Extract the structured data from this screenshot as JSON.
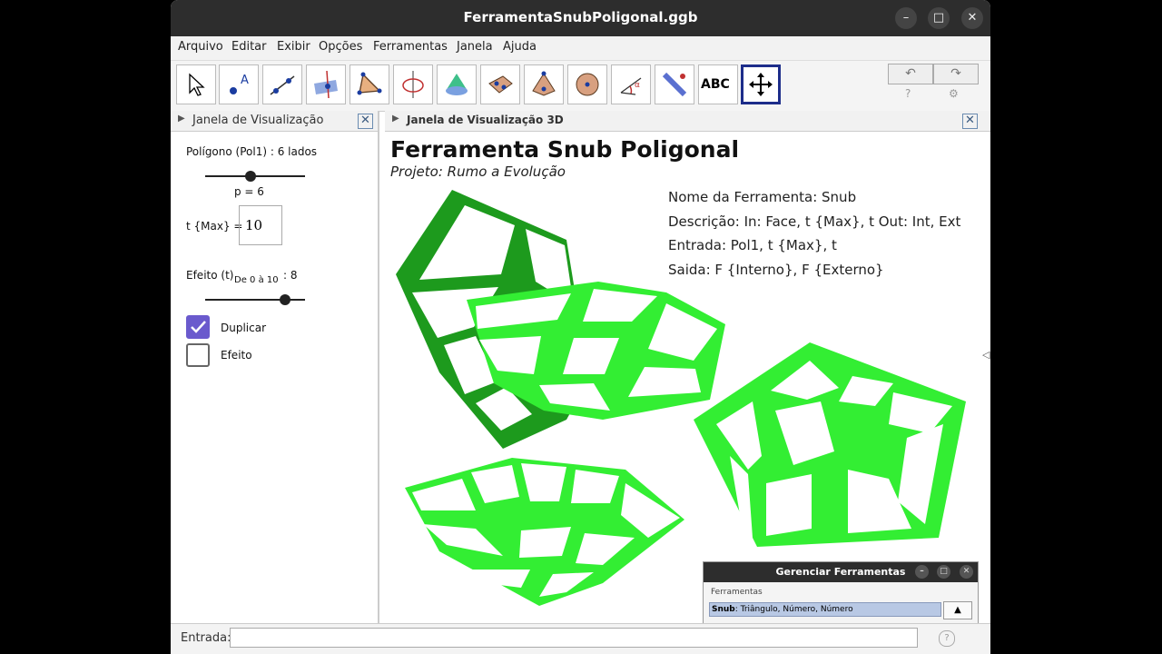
{
  "window": {
    "title": "FerramentaSnubPoligonal.ggb",
    "minimize": "–",
    "maximize": "□",
    "close": "✕"
  },
  "menu": [
    "Arquivo",
    "Editar",
    "Exibir",
    "Opções",
    "Ferramentas",
    "Janela",
    "Ajuda"
  ],
  "toolbar": {
    "tools": [
      "move-tool",
      "point-tool",
      "line-tool",
      "perpendicular-tool",
      "polygon-tool",
      "circle-tool",
      "cone-tool",
      "net-tool",
      "pyramid-tool",
      "sphere-tool",
      "angle-tool",
      "reflect-tool",
      "text-tool",
      "move-view-tool"
    ],
    "text_tool_label": "ABC",
    "undo": "↶",
    "redo": "↷",
    "help": "?",
    "settings": "⚙"
  },
  "left_panel": {
    "header": "Janela de Visualização",
    "polygon_label": "Polígono (Pol1) : 6 lados",
    "p_label": "p = 6",
    "tmax_label": "t {Max} =",
    "tmax_value": "10",
    "effect_label": "Efeito (t)",
    "effect_sub": "De 0 à 10",
    "effect_value": ": 8",
    "p_slider": 0.45,
    "effect_slider": 0.8,
    "checkboxes": [
      {
        "label": "Duplicar",
        "checked": true
      },
      {
        "label": "Efeito",
        "checked": false
      }
    ]
  },
  "view3d": {
    "header": "Janela de Visualização 3D",
    "title": "Ferramenta Snub Poligonal",
    "subtitle": "Projeto: Rumo a Evolução",
    "info": [
      "Nome da Ferramenta: Snub",
      "Descrição: In: Face, t {Max}, t Out: Int, Ext",
      "Entrada: Pol1, t {Max}, t",
      "Saida: F {Interno}, F {Externo}"
    ],
    "collapse_arrow": "◁"
  },
  "tool_manager": {
    "title": "Gerenciar Ferramentas",
    "group_label": "Ferramentas",
    "item_name": "Snub",
    "item_desc": ": Triângulo, Número, Número",
    "up_button": "▲"
  },
  "input_bar": {
    "label": "Entrada:",
    "value": "",
    "help": "?"
  },
  "colors": {
    "green_light": "#33ee33",
    "green_dark": "#117711"
  }
}
